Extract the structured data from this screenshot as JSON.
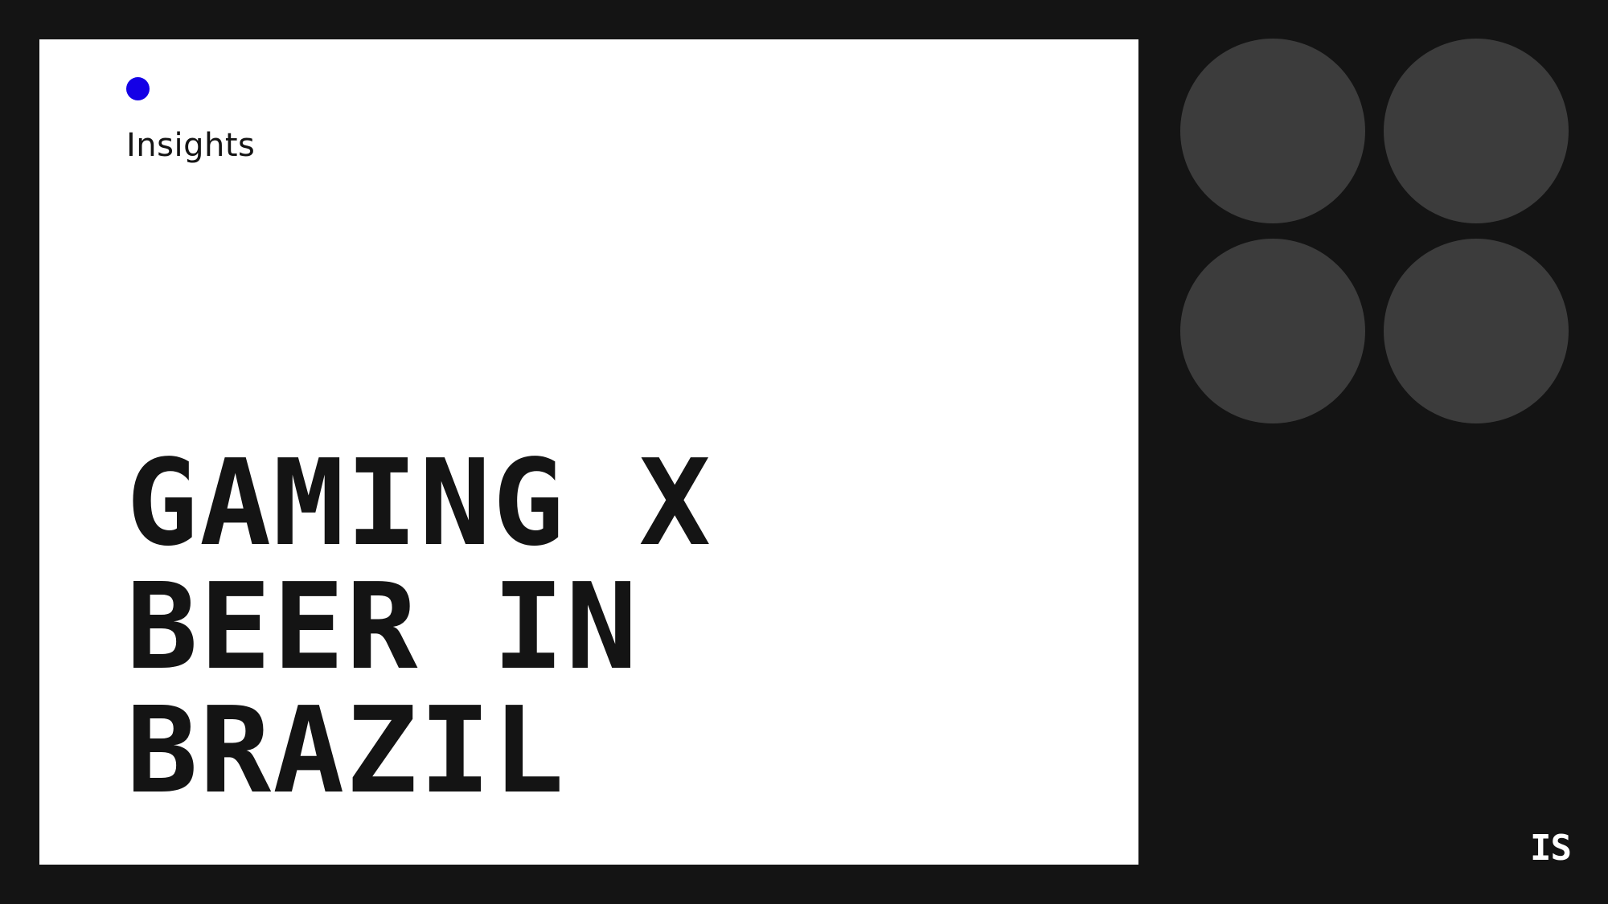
{
  "slide": {
    "kicker": "Insights",
    "headline": "GAMING X\nBEER IN\nBRAZIL",
    "logo_text": "IS"
  },
  "colors": {
    "background": "#141414",
    "card": "#ffffff",
    "accent_dot": "#1400e6",
    "circle": "#3c3c3c",
    "text_dark": "#141414",
    "text_light": "#ffffff"
  }
}
